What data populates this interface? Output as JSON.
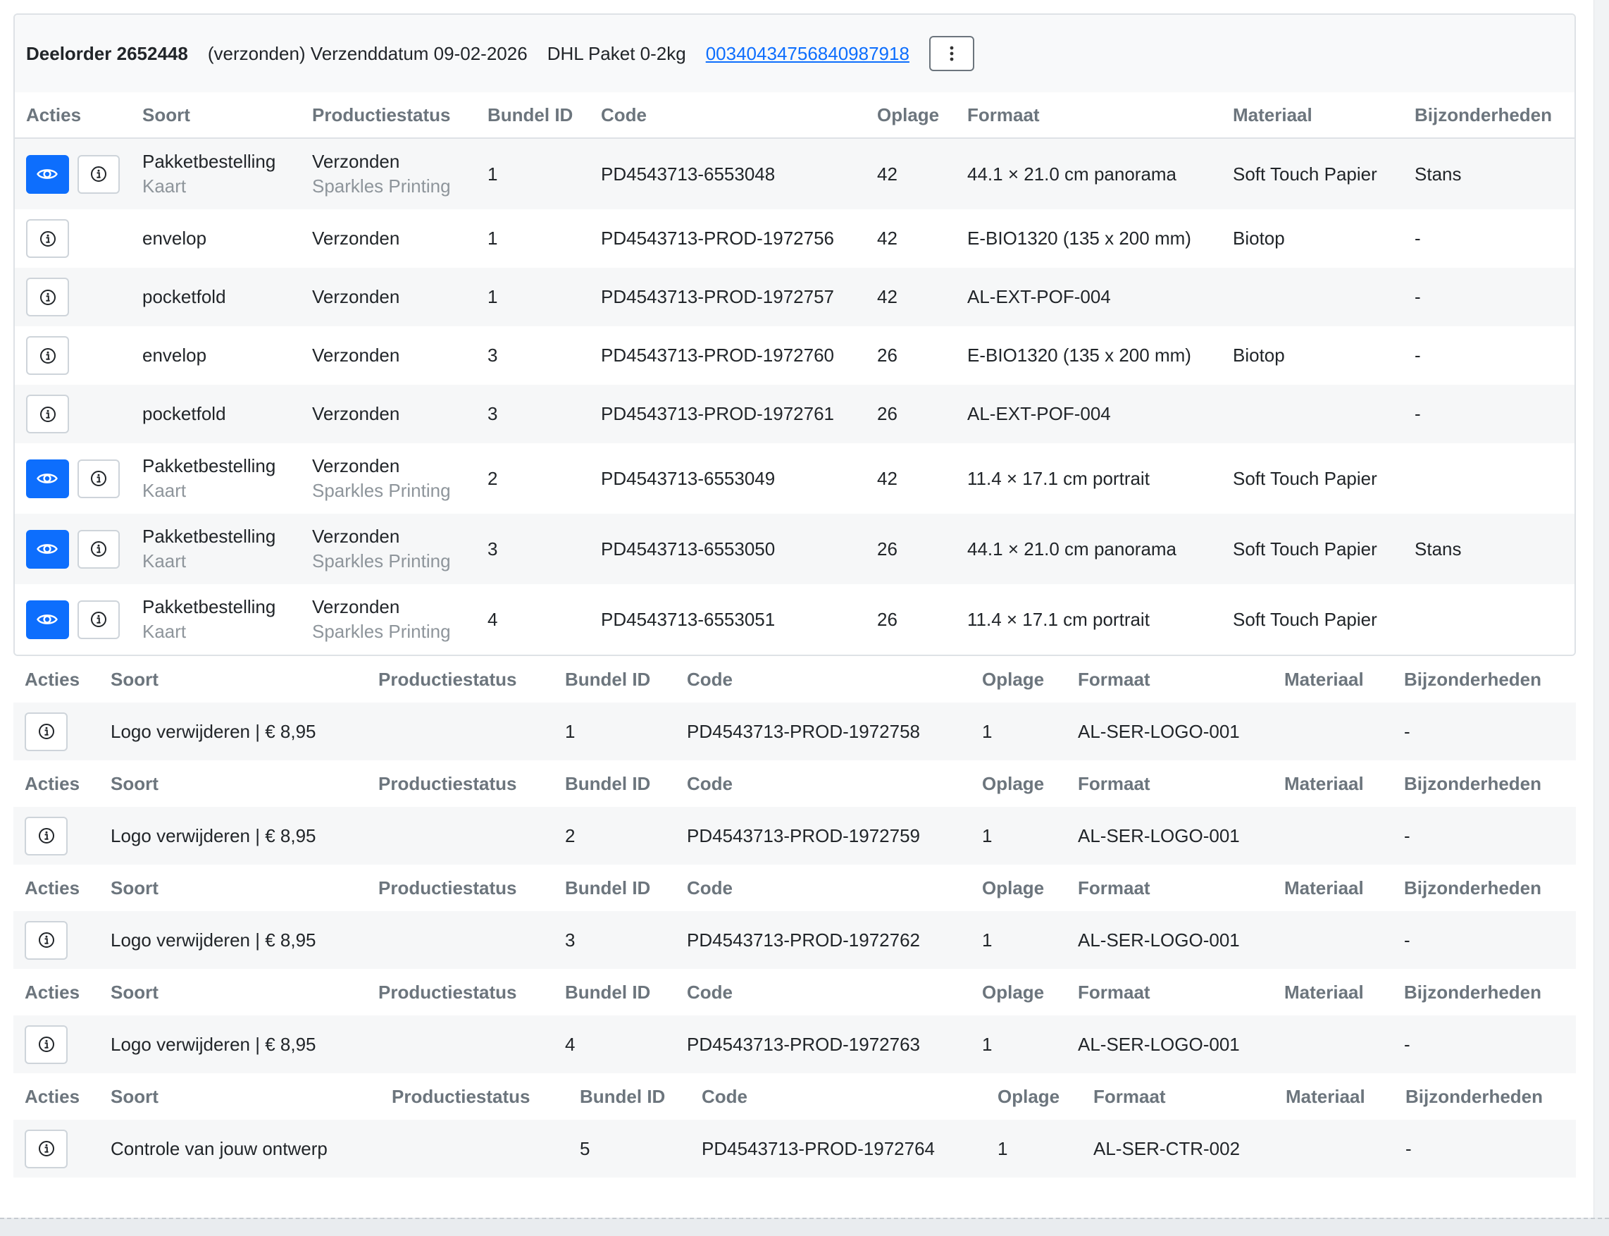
{
  "header": {
    "title": "Deelorder 2652448",
    "status_date": "(verzonden) Verzenddatum 09-02-2026",
    "carrier": "DHL Paket 0-2kg",
    "tracking": "00340434756840987918"
  },
  "columns": {
    "acties": "Acties",
    "soort": "Soort",
    "productiestatus": "Productiestatus",
    "bundel": "Bundel ID",
    "code": "Code",
    "oplage": "Oplage",
    "formaat": "Formaat",
    "materiaal": "Materiaal",
    "bijzonderheden": "Bijzonderheden"
  },
  "rows": [
    {
      "soort": "Pakketbestelling",
      "soort_sub": "Kaart",
      "status": "Verzonden",
      "status_sub": "Sparkles Printing",
      "bundel": "1",
      "code": "PD4543713-6553048",
      "oplage": "42",
      "formaat": "44.1 × 21.0 cm panorama",
      "materiaal": "Soft Touch Papier",
      "bijz": "Stans"
    },
    {
      "soort": "envelop",
      "status": "Verzonden",
      "bundel": "1",
      "code": "PD4543713-PROD-1972756",
      "oplage": "42",
      "formaat": "E-BIO1320 (135 x 200 mm)",
      "materiaal": "Biotop",
      "bijz": "-"
    },
    {
      "soort": "pocketfold",
      "status": "Verzonden",
      "bundel": "1",
      "code": "PD4543713-PROD-1972757",
      "oplage": "42",
      "formaat": "AL-EXT-POF-004",
      "materiaal": "",
      "bijz": "-"
    },
    {
      "soort": "envelop",
      "status": "Verzonden",
      "bundel": "3",
      "code": "PD4543713-PROD-1972760",
      "oplage": "26",
      "formaat": "E-BIO1320 (135 x 200 mm)",
      "materiaal": "Biotop",
      "bijz": "-"
    },
    {
      "soort": "pocketfold",
      "status": "Verzonden",
      "bundel": "3",
      "code": "PD4543713-PROD-1972761",
      "oplage": "26",
      "formaat": "AL-EXT-POF-004",
      "materiaal": "",
      "bijz": "-"
    },
    {
      "soort": "Pakketbestelling",
      "soort_sub": "Kaart",
      "status": "Verzonden",
      "status_sub": "Sparkles Printing",
      "bundel": "2",
      "code": "PD4543713-6553049",
      "oplage": "42",
      "formaat": "11.4 × 17.1 cm portrait",
      "materiaal": "Soft Touch Papier",
      "bijz": ""
    },
    {
      "soort": "Pakketbestelling",
      "soort_sub": "Kaart",
      "status": "Verzonden",
      "status_sub": "Sparkles Printing",
      "bundel": "3",
      "code": "PD4543713-6553050",
      "oplage": "26",
      "formaat": "44.1 × 21.0 cm panorama",
      "materiaal": "Soft Touch Papier",
      "bijz": "Stans"
    },
    {
      "soort": "Pakketbestelling",
      "soort_sub": "Kaart",
      "status": "Verzonden",
      "status_sub": "Sparkles Printing",
      "bundel": "4",
      "code": "PD4543713-6553051",
      "oplage": "26",
      "formaat": "11.4 × 17.1 cm portrait",
      "materiaal": "Soft Touch Papier",
      "bijz": ""
    }
  ],
  "services": [
    {
      "soort": "Logo verwijderen | € 8,95",
      "status": "",
      "bundel": "1",
      "code": "PD4543713-PROD-1972758",
      "oplage": "1",
      "formaat": "AL-SER-LOGO-001",
      "materiaal": "",
      "bijz": "-"
    },
    {
      "soort": "Logo verwijderen | € 8,95",
      "status": "",
      "bundel": "2",
      "code": "PD4543713-PROD-1972759",
      "oplage": "1",
      "formaat": "AL-SER-LOGO-001",
      "materiaal": "",
      "bijz": "-"
    },
    {
      "soort": "Logo verwijderen | € 8,95",
      "status": "",
      "bundel": "3",
      "code": "PD4543713-PROD-1972762",
      "oplage": "1",
      "formaat": "AL-SER-LOGO-001",
      "materiaal": "",
      "bijz": "-"
    },
    {
      "soort": "Logo verwijderen | € 8,95",
      "status": "",
      "bundel": "4",
      "code": "PD4543713-PROD-1972763",
      "oplage": "1",
      "formaat": "AL-SER-LOGO-001",
      "materiaal": "",
      "bijz": "-"
    },
    {
      "soort": "Controle van jouw ontwerp",
      "status": "",
      "bundel": "5",
      "code": "PD4543713-PROD-1972764",
      "oplage": "1",
      "formaat": "AL-SER-CTR-002",
      "materiaal": "",
      "bijz": "-"
    }
  ],
  "icons": {
    "eye": "eye-icon",
    "info": "info-icon",
    "more": "more-vertical-icon"
  },
  "colors": {
    "primary": "#0d6efd",
    "muted": "#6c757d"
  }
}
